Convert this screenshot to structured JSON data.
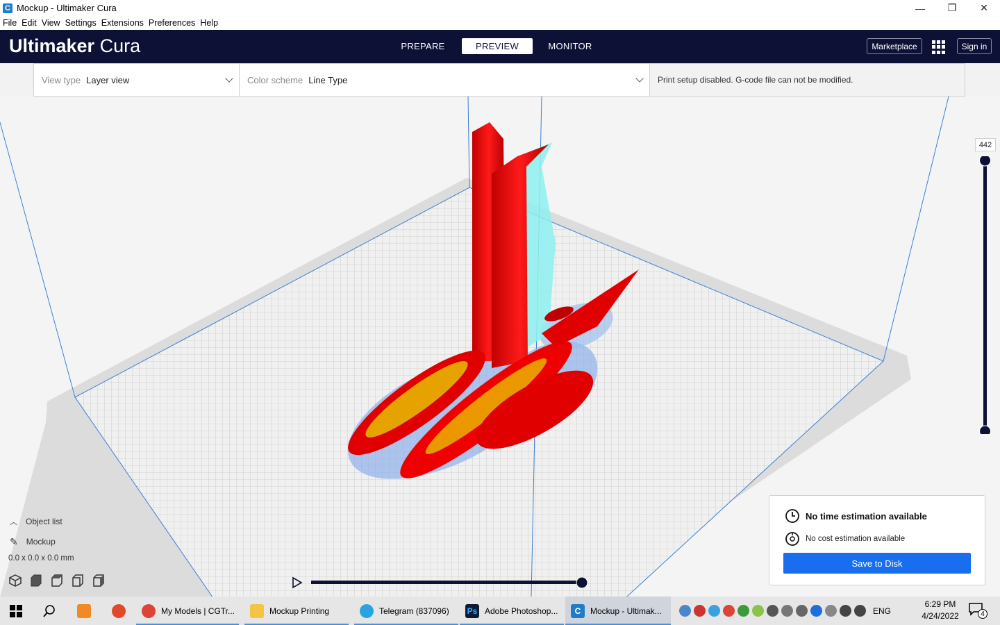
{
  "window": {
    "title": "Mockup - Ultimaker Cura",
    "app_icon_letter": "C",
    "minimize": "—",
    "restore": "❐",
    "close": "✕"
  },
  "menu": [
    "File",
    "Edit",
    "View",
    "Settings",
    "Extensions",
    "Preferences",
    "Help"
  ],
  "header": {
    "logo_bold": "Ultimaker",
    "logo_light": "Cura",
    "stages": [
      "PREPARE",
      "PREVIEW",
      "MONITOR"
    ],
    "active_stage": "PREVIEW",
    "marketplace_label": "Marketplace",
    "signin_label": "Sign in"
  },
  "toolbar": {
    "view_type_label": "View type",
    "view_type_value": "Layer view",
    "color_scheme_label": "Color scheme",
    "color_scheme_value": "Line Type",
    "message": "Print setup disabled. G-code file can not be modified."
  },
  "layer_slider": {
    "current_layer": "442"
  },
  "object_panel": {
    "title": "Object list",
    "object_name": "Mockup",
    "dimensions": "0.0 x 0.0 x 0.0 mm"
  },
  "estimate": {
    "time": "No time estimation available",
    "cost": "No cost estimation available",
    "save_label": "Save to Disk"
  },
  "taskbar": {
    "apps": [
      {
        "label": "My Models | CGTr...",
        "icon_color": "#db4437",
        "icon": "chrome-icon"
      },
      {
        "label": "Mockup Printing",
        "icon_color": "#f4c542",
        "icon": "folder-icon"
      },
      {
        "label": "Telegram (837096)",
        "icon_color": "#2aa3df",
        "icon": "telegram-icon"
      },
      {
        "label": "Adobe Photoshop...",
        "icon_color": "#0b1b33",
        "icon": "photoshop-icon"
      },
      {
        "label": "Mockup - Ultimak...",
        "icon_color": "#1f7cc7",
        "icon": "cura-icon"
      }
    ],
    "language": "ENG",
    "time": "6:29 PM",
    "date": "4/24/2022",
    "notification_count": "4"
  },
  "colors": {
    "header_bg": "#0e1136",
    "accent": "#196ef0",
    "model_red": "#ff0000",
    "support_cyan": "#7fe6e8",
    "skirt_blue": "#8fb0ea",
    "build_line": "#3b7fd6"
  }
}
